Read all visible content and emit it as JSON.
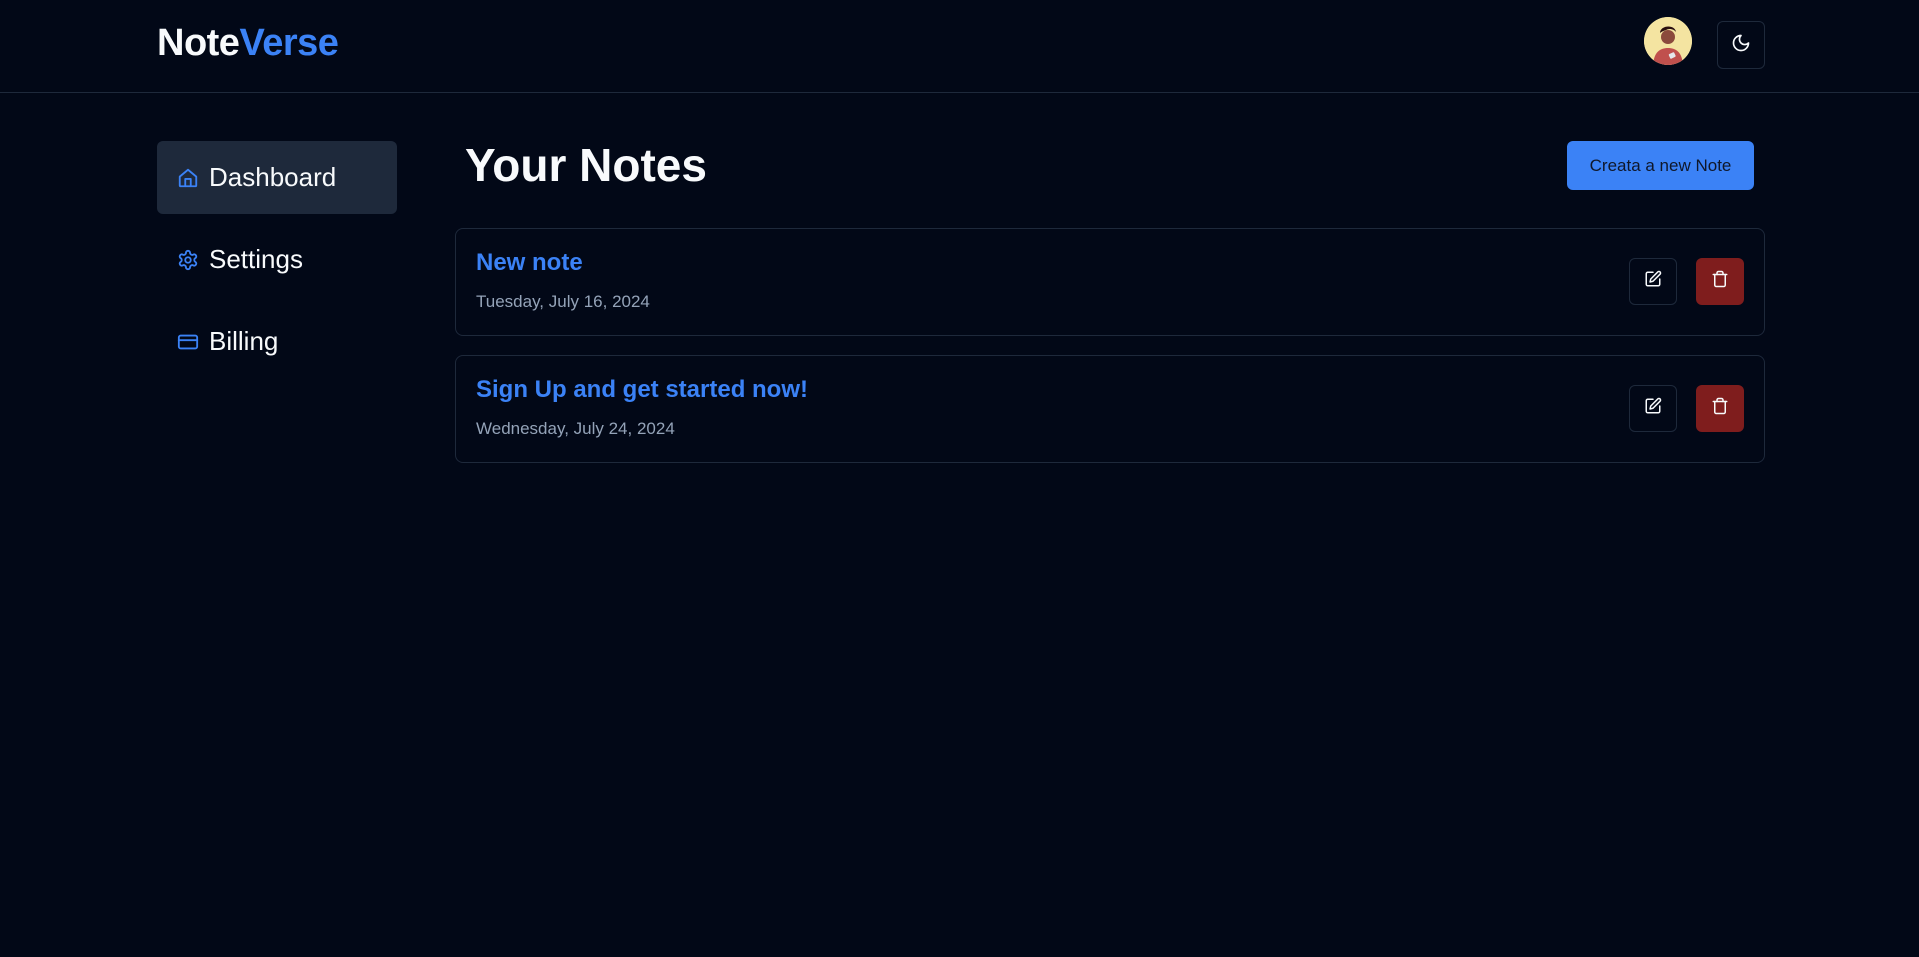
{
  "header": {
    "logo_part1": "Note",
    "logo_part2": "Verse",
    "avatar_icon": "user-avatar",
    "theme_toggle_icon": "moon-icon"
  },
  "sidebar": {
    "items": [
      {
        "label": "Dashboard",
        "icon": "home-icon",
        "active": true
      },
      {
        "label": "Settings",
        "icon": "gear-icon",
        "active": false
      },
      {
        "label": "Billing",
        "icon": "credit-card-icon",
        "active": false
      }
    ]
  },
  "main": {
    "title": "Your Notes",
    "create_button_label": "Creata a new Note",
    "notes": [
      {
        "title": "New note",
        "date": "Tuesday, July 16, 2024"
      },
      {
        "title": "Sign Up and get started now!",
        "date": "Wednesday, July 24, 2024"
      }
    ]
  },
  "colors": {
    "background": "#020817",
    "accent": "#3b82f6",
    "danger": "#7f1d1d",
    "border": "#1e293b",
    "muted_text": "#94a3b8"
  }
}
